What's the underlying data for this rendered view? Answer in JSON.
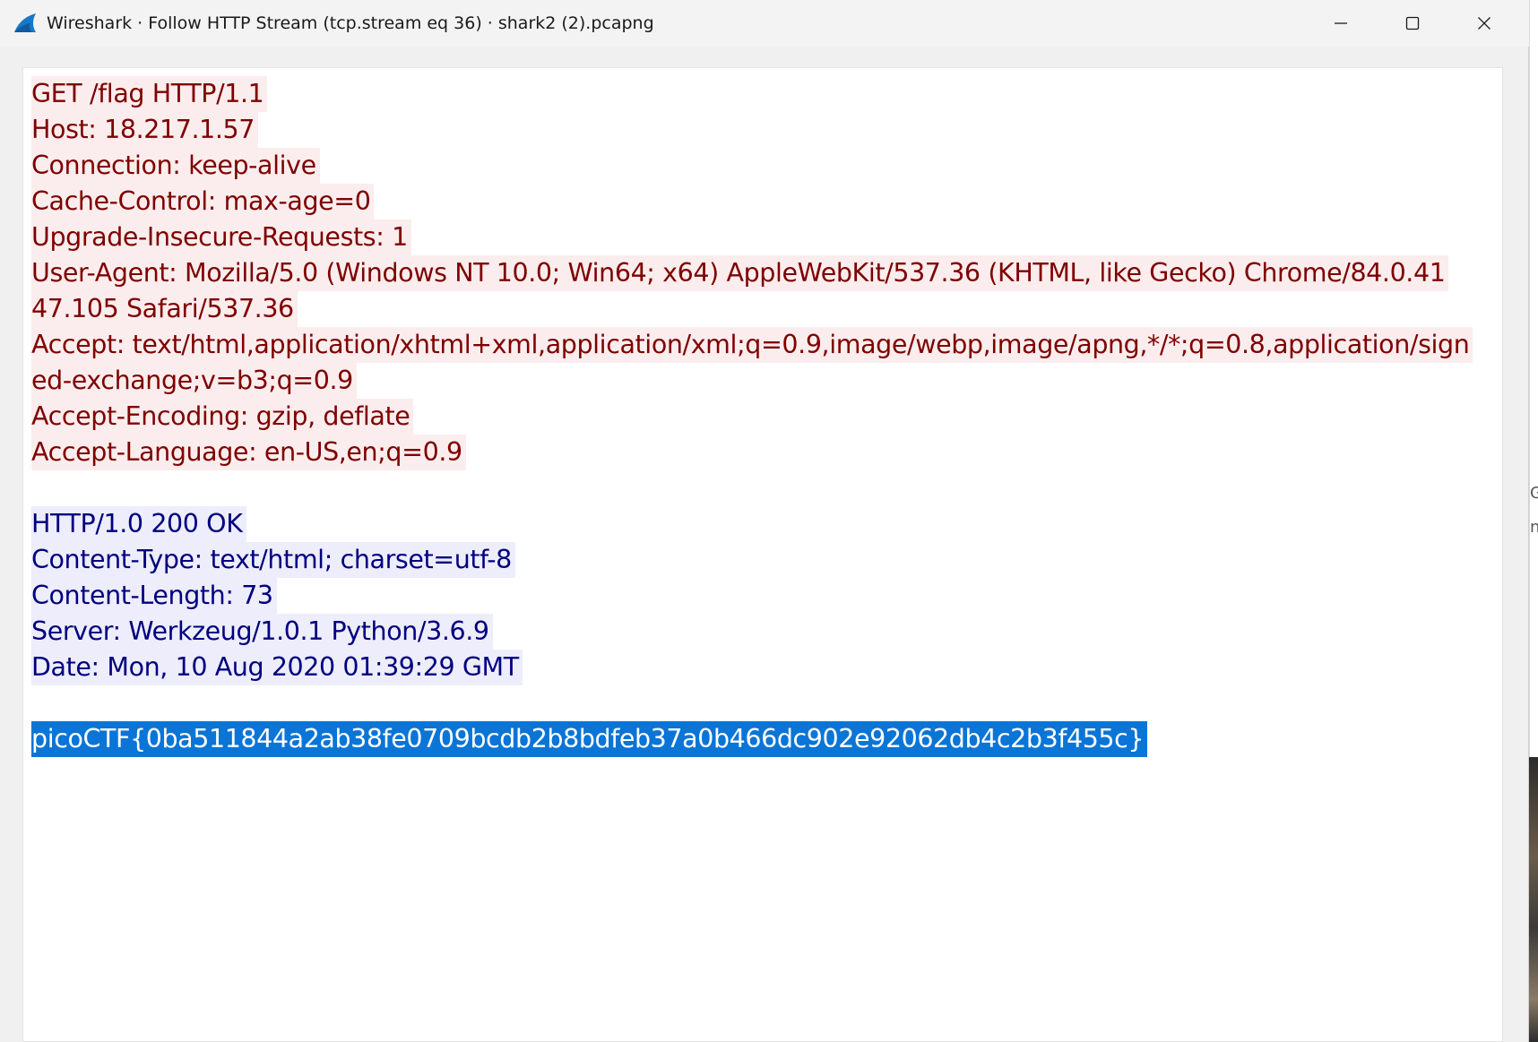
{
  "window": {
    "title": "Wireshark · Follow HTTP Stream (tcp.stream eq 36) · shark2 (2).pcapng",
    "app_icon": "wireshark-fin-icon",
    "controls": {
      "minimize_icon": "minimize-icon",
      "maximize_icon": "maximize-icon",
      "close_icon": "close-icon"
    }
  },
  "stream": {
    "request_color": "#7f0000",
    "request_bg": "#fbeded",
    "response_color": "#000080",
    "response_bg": "#ededfb",
    "selection_bg": "#0a75d6",
    "request_lines": [
      "GET /flag HTTP/1.1",
      "Host: 18.217.1.57",
      "Connection: keep-alive",
      "Cache-Control: max-age=0",
      "Upgrade-Insecure-Requests: 1",
      "User-Agent: Mozilla/5.0 (Windows NT 10.0; Win64; x64) AppleWebKit/537.36 (KHTML, like Gecko) Chrome/84.0.41",
      "47.105 Safari/537.36",
      "Accept: text/html,application/xhtml+xml,application/xml;q=0.9,image/webp,image/apng,*/*;q=0.8,application/sign",
      "ed-exchange;v=b3;q=0.9",
      "Accept-Encoding: gzip, deflate",
      "Accept-Language: en-US,en;q=0.9"
    ],
    "response_lines": [
      "HTTP/1.0 200 OK",
      "Content-Type: text/html; charset=utf-8",
      "Content-Length: 73",
      "Server: Werkzeug/1.0.1 Python/3.6.9",
      "Date: Mon, 10 Aug 2020 01:39:29 GMT"
    ],
    "body_line": "picoCTF{0ba511844a2ab38fe0709bcdb2b8bdfeb37a0b466dc902e92062db4c2b3f455c}"
  },
  "background_window": {
    "glyphs": [
      "G",
      "n"
    ]
  }
}
